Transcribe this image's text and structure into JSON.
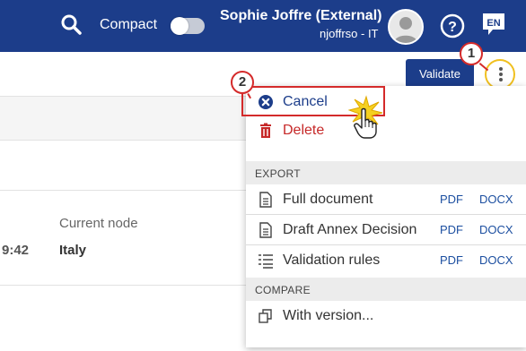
{
  "header": {
    "compact_label": "Compact",
    "compact_on": false,
    "user_name": "Sophie Joffre (External)",
    "user_sub": "njoffrso - IT",
    "lang": "EN"
  },
  "page": {
    "current_node_label": "Current node",
    "current_node_value": "Italy",
    "time_fragment": "9:42",
    "validate_label": "Validate"
  },
  "menu": {
    "cancel_label": "Cancel",
    "delete_label": "Delete",
    "export_header": "EXPORT",
    "export_items": [
      {
        "label": "Full document",
        "pdf": "PDF",
        "docx": "DOCX"
      },
      {
        "label": "Draft Annex Decision",
        "pdf": "PDF",
        "docx": "DOCX"
      },
      {
        "label": "Validation rules",
        "pdf": "PDF",
        "docx": "DOCX"
      }
    ],
    "compare_header": "COMPARE",
    "with_version_label": "With version..."
  },
  "annotations": {
    "step1": "1",
    "step2": "2"
  },
  "colors": {
    "header_bg": "#1c3d8a",
    "accent_blue": "#1c4fa0",
    "danger": "#c62828",
    "annotation_red": "#d42a2a",
    "highlight_ring": "#f0c020"
  }
}
